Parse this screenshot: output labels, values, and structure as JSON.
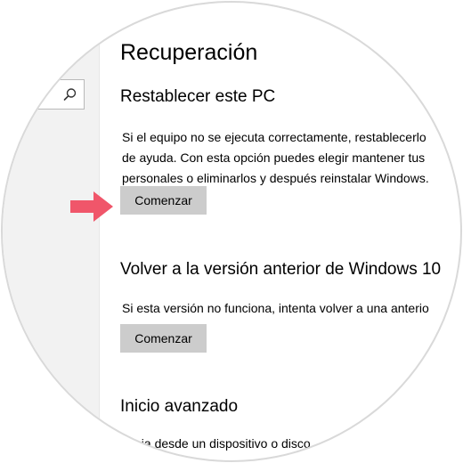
{
  "page": {
    "title": "Recuperación"
  },
  "sidebar": {
    "search_icon": "search-icon"
  },
  "sections": [
    {
      "title": "Restablecer este PC",
      "description": "Si el equipo no se ejecuta correctamente, restablecerlo\nde ayuda. Con esta opción puedes elegir mantener tus\npersonales o eliminarlos y después reinstalar Windows.",
      "button_label": "Comenzar"
    },
    {
      "title": "Volver a la versión anterior de Windows 10",
      "description": "Si esta versión no funciona, intenta volver a una anterio",
      "button_label": "Comenzar"
    },
    {
      "title": "Inicio avanzado",
      "description": "Inicia desde un dispositivo o disco"
    }
  ],
  "annotation": {
    "arrow_icon": "arrow-right-icon",
    "arrow_color": "#f0566a"
  },
  "colors": {
    "button_bg": "#cccccc",
    "sidebar_bg": "#f2f2f2"
  }
}
